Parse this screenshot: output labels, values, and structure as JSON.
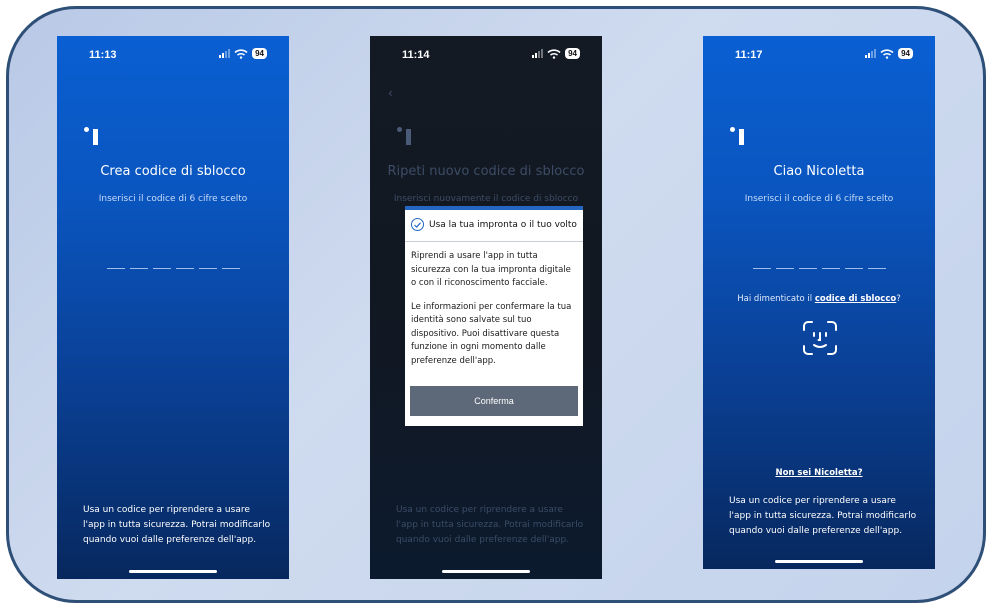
{
  "screens": [
    {
      "time": "11:13",
      "battery": "94",
      "title": "Crea codice di sblocco",
      "subtitle": "Inserisci il codice di 6 cifre scelto",
      "bottom_text": "Usa un codice per riprendere a usare l'app in tutta sicurezza. Potrai modificarlo quando vuoi dalle preferenze dell'app."
    },
    {
      "time": "11:14",
      "battery": "94",
      "back_label": "‹",
      "title": "Ripeti nuovo codice di sblocco",
      "subtitle": "Inserisci nuovamente il codice di sblocco",
      "bottom_text": "Usa un codice per riprendere a usare l'app in tutta sicurezza. Potrai modificarlo quando vuoi dalle preferenze dell'app.",
      "modal": {
        "title": "Usa la tua impronta o il tuo volto",
        "paragraph1": "Riprendi a usare l'app in tutta sicurezza con la tua impronta digitale o con il riconoscimento facciale.",
        "paragraph2": "Le informazioni per confermare la tua identità sono salvate sul tuo dispositivo. Puoi disattivare questa funzione in ogni momento dalle preferenze dell'app.",
        "confirm_label": "Conferma"
      }
    },
    {
      "time": "11:17",
      "battery": "94",
      "title": "Ciao Nicoletta",
      "subtitle": "Inserisci il codice di 6 cifre scelto",
      "forgot_prefix": "Hai dimenticato il ",
      "forgot_link": "codice di sblocco",
      "forgot_suffix": "?",
      "not_you": "Non sei Nicoletta?",
      "bottom_text": "Usa un codice per riprendere a usare l'app in tutta sicurezza. Potrai modificarlo quando vuoi dalle preferenze dell'app."
    }
  ],
  "colors": {
    "frame_border": "#2e4f77",
    "phone_blue": "#0a5fd2",
    "modal_accent": "#2466c2",
    "confirm_button": "#5d6879"
  },
  "icons": [
    "signal-icon",
    "wifi-icon",
    "battery-icon",
    "app-logo-icon",
    "check-circle-icon",
    "face-id-icon",
    "back-chevron-icon"
  ]
}
